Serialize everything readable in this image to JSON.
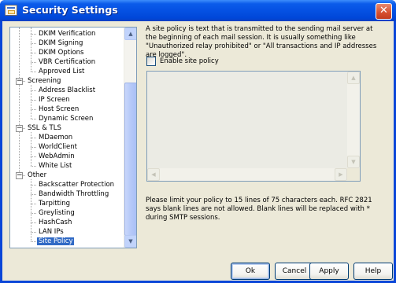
{
  "window": {
    "title": "Security Settings",
    "close_glyph": "✕"
  },
  "tree": {
    "collapse_glyph": "−",
    "items": [
      {
        "label": "DKIM Verification",
        "level": 2
      },
      {
        "label": "DKIM Signing",
        "level": 2
      },
      {
        "label": "DKIM Options",
        "level": 2
      },
      {
        "label": "VBR Certification",
        "level": 2
      },
      {
        "label": "Approved List",
        "level": 2
      },
      {
        "label": "Screening",
        "level": 1
      },
      {
        "label": "Address Blacklist",
        "level": 2
      },
      {
        "label": "IP Screen",
        "level": 2
      },
      {
        "label": "Host Screen",
        "level": 2
      },
      {
        "label": "Dynamic Screen",
        "level": 2
      },
      {
        "label": "SSL & TLS",
        "level": 1
      },
      {
        "label": "MDaemon",
        "level": 2
      },
      {
        "label": "WorldClient",
        "level": 2
      },
      {
        "label": "WebAdmin",
        "level": 2
      },
      {
        "label": "White List",
        "level": 2
      },
      {
        "label": "Other",
        "level": 1
      },
      {
        "label": "Backscatter Protection",
        "level": 2
      },
      {
        "label": "Bandwidth Throttling",
        "level": 2
      },
      {
        "label": "Tarpitting",
        "level": 2
      },
      {
        "label": "Greylisting",
        "level": 2
      },
      {
        "label": "HashCash",
        "level": 2
      },
      {
        "label": "LAN IPs",
        "level": 2
      },
      {
        "label": "Site Policy",
        "level": 2,
        "selected": true
      }
    ]
  },
  "content": {
    "description": "A site policy is text that is transmitted to the sending mail server at the beginning of each mail session.  It is usually something like \"Unauthorized relay prohibited\" or \"All transactions and IP addresses are logged\".",
    "enable_label": "Enable site policy",
    "enable_checked": false,
    "policy_text": "",
    "note": "Please limit your policy to 15 lines of 75 characters each.  RFC 2821 says blank lines are not allowed.  Blank lines will be replaced with * during SMTP sessions."
  },
  "buttons": {
    "ok": "Ok",
    "cancel": "Cancel",
    "apply": "Apply",
    "help": "Help"
  },
  "colors": {
    "titlebar": "#0551e3",
    "selection": "#316ac5",
    "dialog_bg": "#ece9d8"
  }
}
